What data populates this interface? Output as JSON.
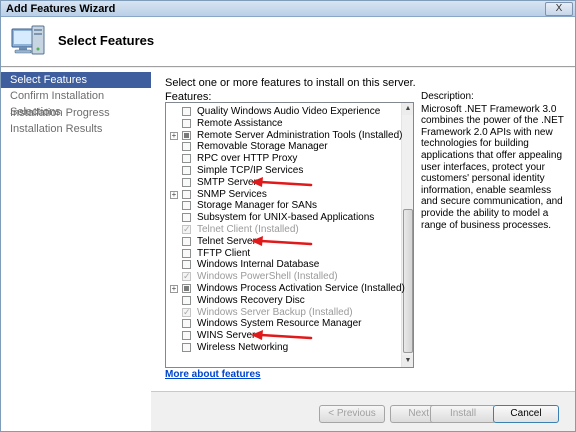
{
  "window": {
    "title": "Add Features Wizard",
    "close_glyph": "X"
  },
  "header": {
    "title": "Select Features",
    "icon": "computer-features-icon"
  },
  "nav": {
    "items": [
      {
        "label": "Select Features",
        "active": true
      },
      {
        "label": "Confirm Installation Selections",
        "active": false
      },
      {
        "label": "Installation Progress",
        "active": false
      },
      {
        "label": "Installation Results",
        "active": false
      }
    ]
  },
  "main": {
    "instruction": "Select one or more features to install on this server.",
    "features_label": "Features:",
    "features": [
      {
        "label": "Quality Windows Audio Video Experience",
        "checked": false,
        "disabled": false,
        "expandable": false,
        "partial": false
      },
      {
        "label": "Remote Assistance",
        "checked": false,
        "disabled": false,
        "expandable": false,
        "partial": false
      },
      {
        "label": "Remote Server Administration Tools  (Installed)",
        "checked": false,
        "disabled": false,
        "expandable": true,
        "partial": true
      },
      {
        "label": "Removable Storage Manager",
        "checked": false,
        "disabled": false,
        "expandable": false,
        "partial": false
      },
      {
        "label": "RPC over HTTP Proxy",
        "checked": false,
        "disabled": false,
        "expandable": false,
        "partial": false
      },
      {
        "label": "Simple TCP/IP Services",
        "checked": false,
        "disabled": false,
        "expandable": false,
        "partial": false
      },
      {
        "label": "SMTP Server",
        "checked": false,
        "disabled": false,
        "expandable": false,
        "partial": false
      },
      {
        "label": "SNMP Services",
        "checked": false,
        "disabled": false,
        "expandable": true,
        "partial": false
      },
      {
        "label": "Storage Manager for SANs",
        "checked": false,
        "disabled": false,
        "expandable": false,
        "partial": false
      },
      {
        "label": "Subsystem for UNIX-based Applications",
        "checked": false,
        "disabled": false,
        "expandable": false,
        "partial": false
      },
      {
        "label": "Telnet Client  (Installed)",
        "checked": true,
        "disabled": true,
        "expandable": false,
        "partial": false
      },
      {
        "label": "Telnet Server",
        "checked": false,
        "disabled": false,
        "expandable": false,
        "partial": false
      },
      {
        "label": "TFTP Client",
        "checked": false,
        "disabled": false,
        "expandable": false,
        "partial": false
      },
      {
        "label": "Windows Internal Database",
        "checked": false,
        "disabled": false,
        "expandable": false,
        "partial": false
      },
      {
        "label": "Windows PowerShell  (Installed)",
        "checked": true,
        "disabled": true,
        "expandable": false,
        "partial": false
      },
      {
        "label": "Windows Process Activation Service  (Installed)",
        "checked": false,
        "disabled": false,
        "expandable": true,
        "partial": true
      },
      {
        "label": "Windows Recovery Disc",
        "checked": false,
        "disabled": false,
        "expandable": false,
        "partial": false
      },
      {
        "label": "Windows Server Backup  (Installed)",
        "checked": true,
        "disabled": true,
        "expandable": false,
        "partial": false
      },
      {
        "label": "Windows System Resource Manager",
        "checked": false,
        "disabled": false,
        "expandable": false,
        "partial": false
      },
      {
        "label": "WINS Server",
        "checked": false,
        "disabled": false,
        "expandable": false,
        "partial": false
      },
      {
        "label": "Wireless Networking",
        "checked": false,
        "disabled": false,
        "expandable": false,
        "partial": false
      }
    ],
    "arrow_targets": [
      "SMTP Server",
      "Telnet Server",
      "WINS Server"
    ],
    "description_label": "Description:",
    "description_text": "Microsoft .NET Framework 3.0 combines the power of the .NET Framework 2.0 APIs with new technologies for building applications that offer appealing user interfaces, protect your customers' personal identity information, enable seamless and secure communication, and provide the ability to model a range of business processes.",
    "more_link": "More about features"
  },
  "footer": {
    "previous": "< Previous",
    "next": "Next >",
    "install": "Install",
    "cancel": "Cancel"
  },
  "colors": {
    "nav_active": "#3e5e9e",
    "arrow": "#e0191b",
    "link": "#0044cc"
  }
}
